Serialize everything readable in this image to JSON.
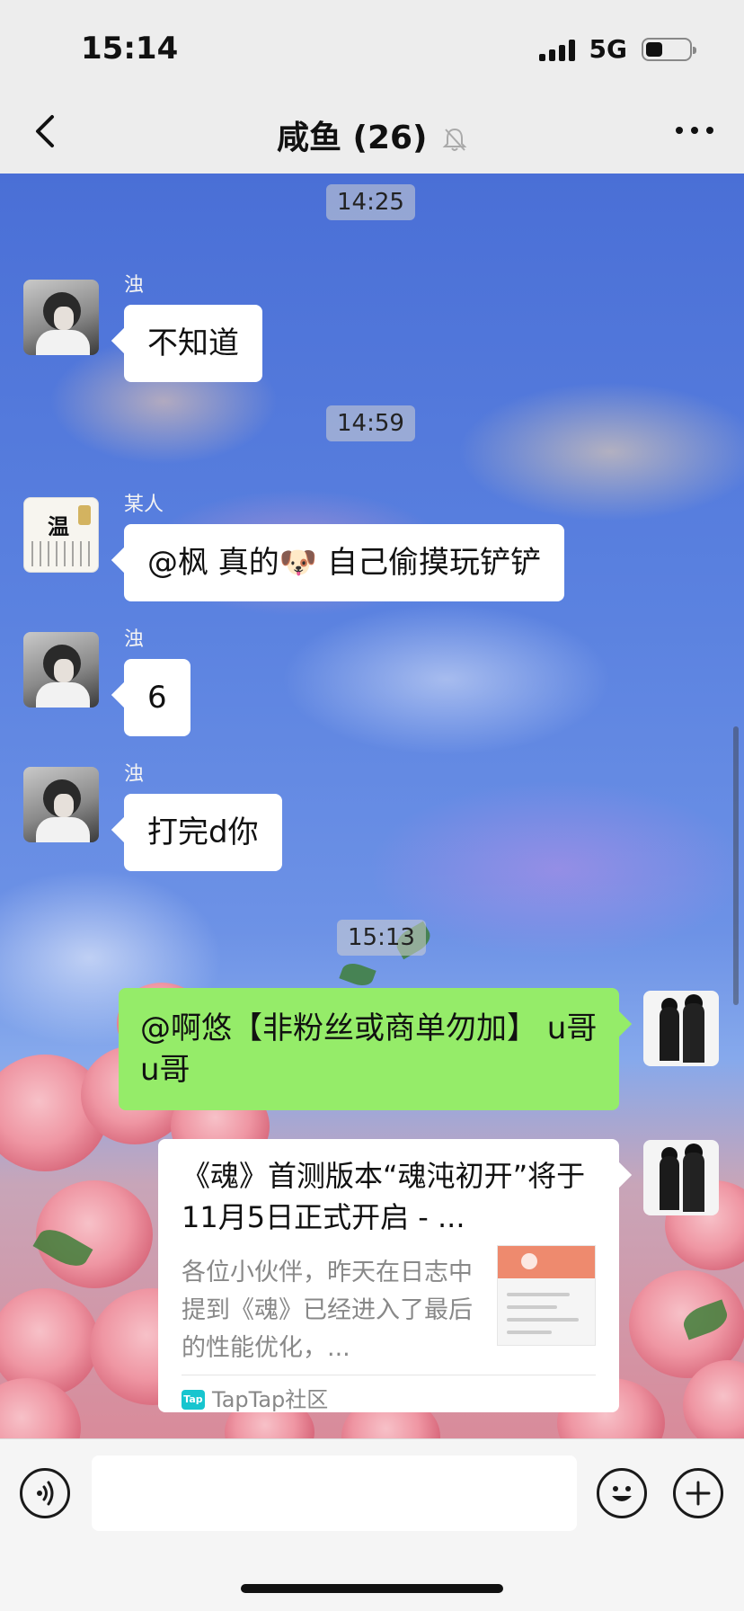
{
  "status_bar": {
    "time": "15:14",
    "network": "5G"
  },
  "nav": {
    "title": "咸鱼 (26)"
  },
  "messages": {
    "time1": "14:25",
    "m1": {
      "sender": "浊",
      "text": "不知道"
    },
    "time2": "14:59",
    "m2": {
      "sender": "某人",
      "text": "@枫 真的🐶 自己偷摸玩铲铲"
    },
    "m3": {
      "sender": "浊",
      "text": "6"
    },
    "m4": {
      "sender": "浊",
      "text": "打完d你"
    },
    "time3": "15:13",
    "m5": {
      "text": "@啊悠【非粉丝或商单勿加】 u哥u哥"
    },
    "link": {
      "title": "《魂》首测版本“魂沌初开”将于11月5日正式开启 - ...",
      "desc": "各位小伙伴，昨天在日志中提到《魂》已经进入了最后的性能优化，...",
      "source": "TapTap社区",
      "logo": "Tap"
    }
  },
  "avatars": {
    "wen_glyph": "温"
  },
  "icons": [
    "back-chevron-icon",
    "mute-bell-icon",
    "more-dots-icon",
    "voice-icon",
    "emoji-icon",
    "plus-icon",
    "dog-emoji"
  ],
  "colors": {
    "my_bubble": "#95ec69",
    "other_bubble": "#ffffff",
    "bar_bg": "#ededed"
  }
}
